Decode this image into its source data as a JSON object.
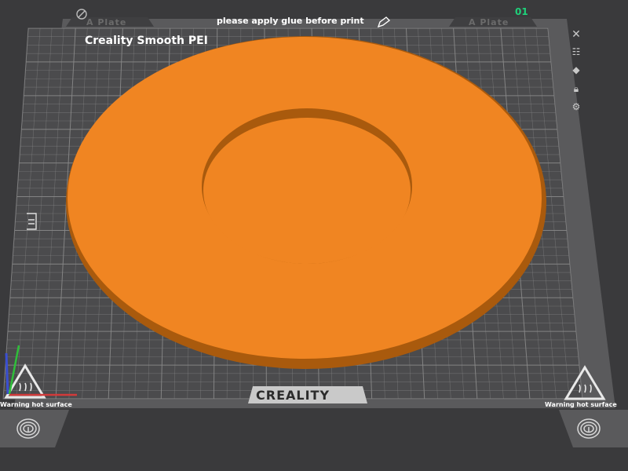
{
  "plate": {
    "name_left": "A Plate",
    "name_right": "A Plate",
    "note": "please apply glue before print",
    "index": "01",
    "bed_label": "Creality Smooth PEI",
    "brand": "CREALITY",
    "warning_left": "Warning hot surface",
    "warning_right": "Warning hot surface"
  },
  "colors": {
    "background": "#3a3a3c",
    "bed": "#4b4b4d",
    "grid": "#8a8a8a",
    "model": "#f08522",
    "model_edge": "#a95a0d",
    "plate_index": "#1fd17a"
  },
  "toolbar": {
    "icons": [
      "close-icon",
      "arrange-icon",
      "orient-icon",
      "lock-icon",
      "settings-icon"
    ]
  },
  "axes": {
    "x_color": "#d23a3a",
    "y_color": "#2fbf3a",
    "z_color": "#3a4fd2"
  }
}
